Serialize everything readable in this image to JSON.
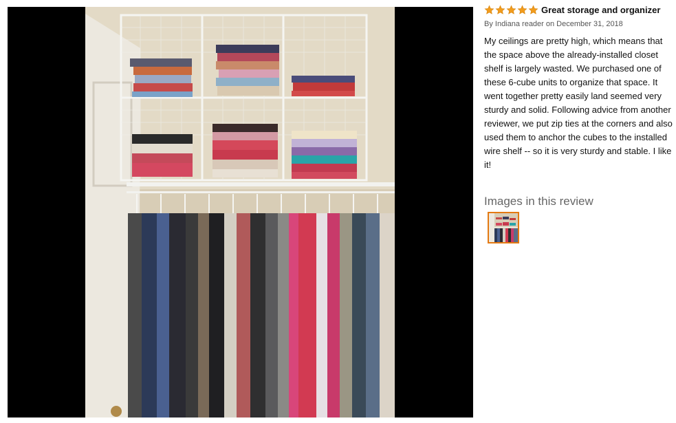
{
  "review": {
    "rating": 5,
    "rating_max": 5,
    "title": "Great storage and organizer",
    "byline": "By Indiana reader on December 31, 2018",
    "body": "My ceilings are pretty high, which means that the space above the already-installed closet shelf is largely wasted. We purchased one of these 6-cube units to organize that space. It went together pretty easily land seemed very sturdy and solid. Following advice from another reviewer, we put zip ties at the corners and also used them to anchor the cubes to the installed wire shelf -- so it is very sturdy and stable. I like it!",
    "images_heading": "Images in this review"
  },
  "colors": {
    "star": "#f29c1c",
    "thumb_border": "#e47911",
    "photo_backdrop": "#000000"
  },
  "icons": {
    "star": "star-icon"
  }
}
